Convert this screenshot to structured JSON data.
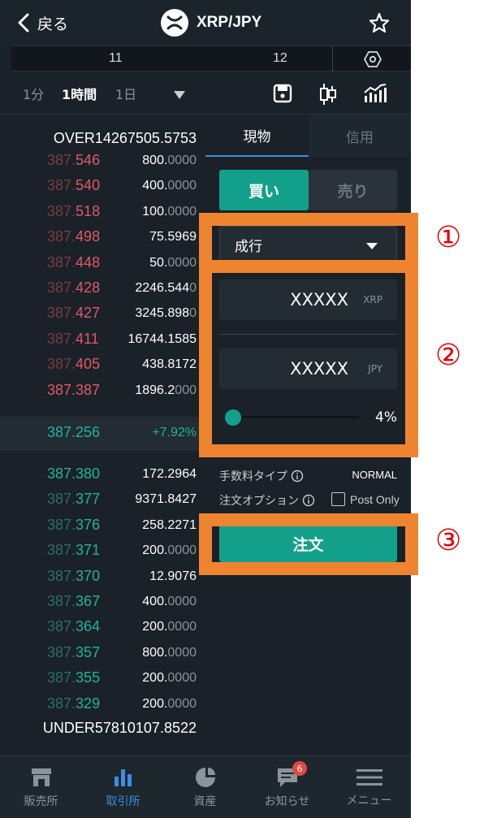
{
  "header": {
    "back_label": "戻る",
    "pair": "XRP/JPY",
    "coin_icon": "xrp-logo-icon"
  },
  "chart_axis": {
    "labels": [
      "11",
      "12"
    ]
  },
  "timeframes": {
    "items": [
      "1分",
      "1時間",
      "1日"
    ],
    "selected": "1時間"
  },
  "orderbook": {
    "over": "OVER14267505.5753",
    "asks": [
      {
        "p1": "387.",
        "p2": "546",
        "q1": "800.",
        "q2": "0000"
      },
      {
        "p1": "387.",
        "p2": "540",
        "q1": "400.",
        "q2": "0000"
      },
      {
        "p1": "387.",
        "p2": "518",
        "q1": "100.",
        "q2": "0000"
      },
      {
        "p1": "387.",
        "p2": "498",
        "q1": "75.5969",
        "q2": ""
      },
      {
        "p1": "387.",
        "p2": "448",
        "q1": "50.",
        "q2": "0000"
      },
      {
        "p1": "387.",
        "p2": "428",
        "q1": "2246.544",
        "q2": "0"
      },
      {
        "p1": "387.",
        "p2": "427",
        "q1": "3245.898",
        "q2": "0"
      },
      {
        "p1": "387.",
        "p2": "411",
        "q1": "16744.1585",
        "q2": ""
      },
      {
        "p1": "387.",
        "p2": "405",
        "q1": "438.8172",
        "q2": ""
      },
      {
        "p1": "387.387",
        "p2": "",
        "q1": "1896.2",
        "q2": "000"
      }
    ],
    "last_price": "387.256",
    "change": "+7.92%",
    "bids": [
      {
        "p1": "387.380",
        "p2": "",
        "q1": "172.2964",
        "q2": ""
      },
      {
        "p1": "387.",
        "p2": "377",
        "q1": "9371.8427",
        "q2": ""
      },
      {
        "p1": "387.",
        "p2": "376",
        "q1": "258.2271",
        "q2": ""
      },
      {
        "p1": "387.",
        "p2": "371",
        "q1": "200.",
        "q2": "0000"
      },
      {
        "p1": "387.",
        "p2": "370",
        "q1": "12.9076",
        "q2": ""
      },
      {
        "p1": "387.",
        "p2": "367",
        "q1": "400.",
        "q2": "0000"
      },
      {
        "p1": "387.",
        "p2": "364",
        "q1": "200.",
        "q2": "0000"
      },
      {
        "p1": "387.",
        "p2": "357",
        "q1": "800.",
        "q2": "0000"
      },
      {
        "p1": "387.",
        "p2": "355",
        "q1": "200.",
        "q2": "0000"
      },
      {
        "p1": "387.",
        "p2": "329",
        "q1": "200.",
        "q2": "0000"
      }
    ],
    "under": "UNDER57810107.8522"
  },
  "order_form": {
    "tab_spot": "現物",
    "tab_margin": "信用",
    "buy_label": "買い",
    "sell_label": "売り",
    "order_type": "成行",
    "amount_value": "XXXXX",
    "amount_unit": "XRP",
    "total_value": "XXXXX",
    "total_unit": "JPY",
    "slider_percent": "4%",
    "slider_level": 0.04,
    "fee_type_label": "手数料タイプ",
    "fee_type_value": "NORMAL",
    "order_option_label": "注文オプション",
    "post_only_label": "Post Only",
    "submit_label": "注文"
  },
  "nav": {
    "items": [
      {
        "label": "販売所",
        "icon": "store-icon"
      },
      {
        "label": "取引所",
        "icon": "bar-chart-icon"
      },
      {
        "label": "資産",
        "icon": "pie-chart-icon"
      },
      {
        "label": "お知らせ",
        "icon": "message-icon"
      },
      {
        "label": "メニュー",
        "icon": "menu-icon"
      }
    ],
    "active": "取引所",
    "notification_badge": "6"
  },
  "annotations": {
    "marker1": "①",
    "marker2": "②",
    "marker3": "③"
  },
  "colors": {
    "accent": "#13a08a",
    "ask": "#e05a63",
    "bid": "#1fb39d",
    "callout": "#ee8430",
    "marker": "#e50000"
  }
}
